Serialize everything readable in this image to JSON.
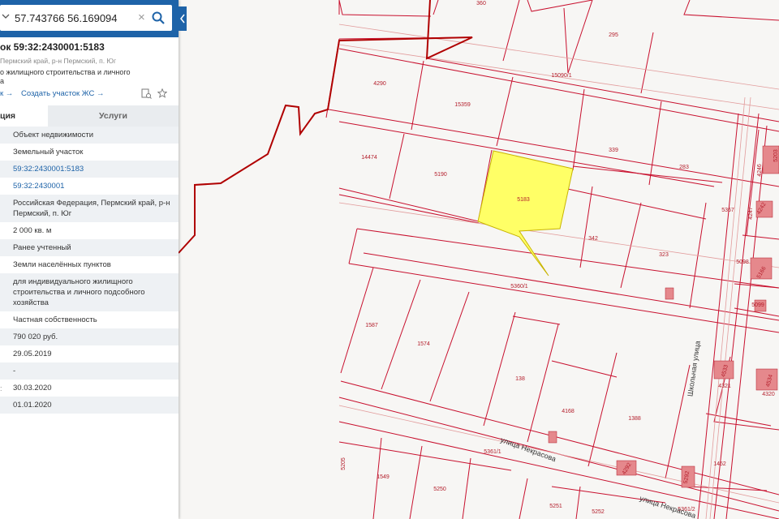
{
  "search": {
    "value": "57.743766 56.169094"
  },
  "parcel": {
    "title": "ок 59:32:2430001:5183",
    "address": "Пермский край, р-н Пермский, п. Юг",
    "purpose_line1": "о жилищного строительства и личного",
    "purpose_line2": "а"
  },
  "links": {
    "prev": "к →",
    "create": "Создать участок ЖС →"
  },
  "tabs": {
    "info": "ция",
    "services": "Услуги"
  },
  "rows": [
    {
      "text": "Объект недвижимости"
    },
    {
      "text": "Земельный участок"
    },
    {
      "text": "59:32:2430001:5183"
    },
    {
      "text": "59:32:2430001"
    },
    {
      "text": "Российская Федерация, Пермский край, р-н Пермский, п. Юг"
    },
    {
      "text": "2 000 кв. м"
    },
    {
      "text": "Ранее учтенный"
    },
    {
      "text": "Земли населённых пунктов"
    },
    {
      "text": "для индивидуального жилищного строительства и личного подсобного хозяйства"
    },
    {
      "text": "Частная собственность"
    },
    {
      "text": "790 020 руб."
    },
    {
      "text": "29.05.2019"
    },
    {
      "text": "-"
    },
    {
      "text": "30.03.2020",
      "mark": ":"
    },
    {
      "text": "01.01.2020"
    }
  ],
  "map": {
    "colors": {
      "parcel_line": "#c8102e",
      "district_line": "#b00000",
      "selected_fill": "#ffff66",
      "selected_border": "#c8b400",
      "building_fill": "#e5888c",
      "label": "#b31d2a"
    },
    "parcel_labels": [
      "360",
      "295",
      "15090/1",
      "4290",
      "15359",
      "14474",
      "5190",
      "5183",
      "339",
      "283",
      "4246",
      "5367",
      "4247",
      "342",
      "323",
      "5098",
      "5166",
      "5360/1",
      "5099",
      "1587",
      "1574",
      "138",
      "4321",
      "4320",
      "4168",
      "1388",
      "5361/1",
      "5205",
      "1549",
      "5250",
      "5251",
      "5252",
      "1452",
      "5361/2",
      "4533",
      "4534",
      "4292",
      "5292",
      "5203",
      "4242"
    ],
    "street_labels": [
      "улица Некрасова",
      "Школьная улица",
      "улица Некрасова"
    ]
  }
}
